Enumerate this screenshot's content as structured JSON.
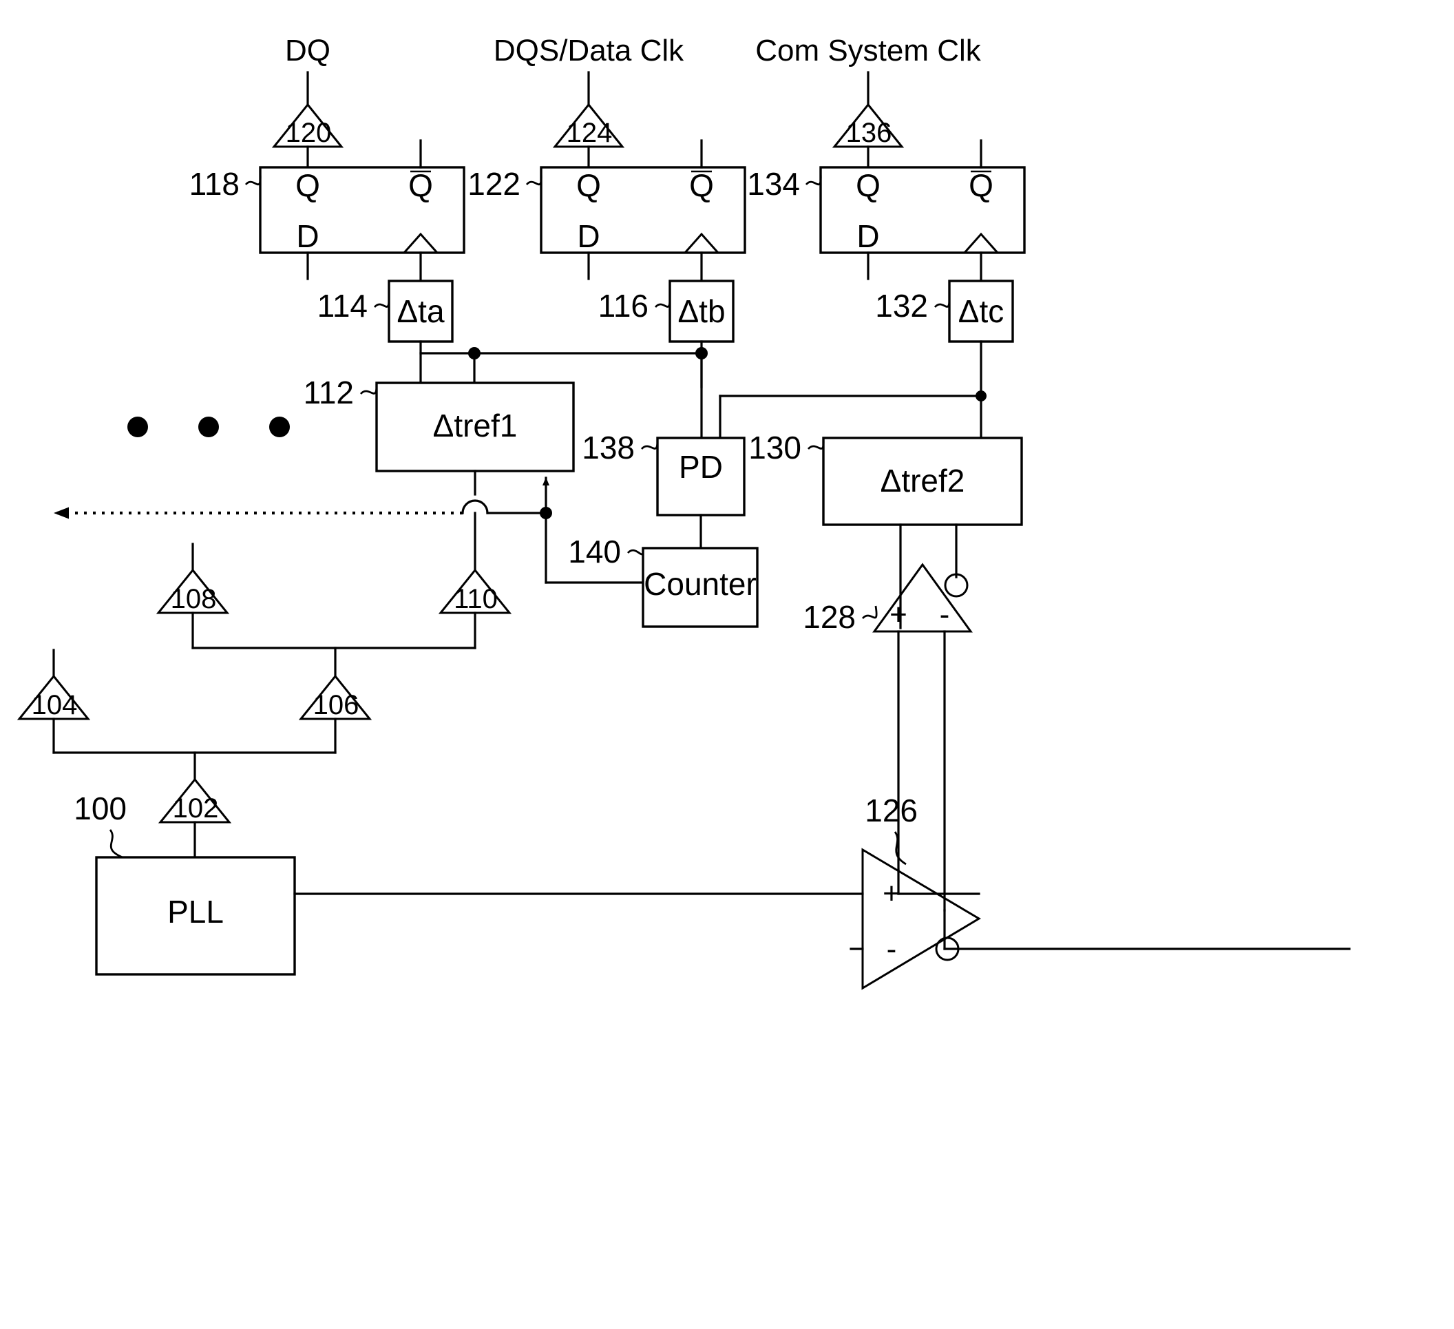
{
  "figure": {
    "type": "patent-circuit-diagram",
    "background": "#ffffff",
    "line_color": "#000000"
  },
  "signal_labels": {
    "dq": "DQ",
    "dqs": "DQS/Data Clk",
    "com_clk": "Com System Clk"
  },
  "flipflops": [
    {
      "ref": "118",
      "q": "Q",
      "qbar": "Q",
      "d": "D"
    },
    {
      "ref": "122",
      "q": "Q",
      "qbar": "Q",
      "d": "D"
    },
    {
      "ref": "134",
      "q": "Q",
      "qbar": "Q",
      "d": "D"
    }
  ],
  "buffers": [
    {
      "ref": "120"
    },
    {
      "ref": "124"
    },
    {
      "ref": "136"
    },
    {
      "ref": "102"
    },
    {
      "ref": "104"
    },
    {
      "ref": "106"
    },
    {
      "ref": "108"
    },
    {
      "ref": "110"
    }
  ],
  "delay_blocks": [
    {
      "ref": "114",
      "label": "Δta"
    },
    {
      "ref": "116",
      "label": "Δtb"
    },
    {
      "ref": "132",
      "label": "Δtc"
    },
    {
      "ref": "112",
      "label": "Δtref1"
    },
    {
      "ref": "130",
      "label": "Δtref2"
    }
  ],
  "logic_blocks": [
    {
      "ref": "100",
      "label": "PLL"
    },
    {
      "ref": "138",
      "label": "PD"
    },
    {
      "ref": "140",
      "label": "Counter"
    }
  ],
  "comparators": [
    {
      "ref": "126",
      "plus": "+",
      "minus": "-",
      "orientation": "right",
      "inverted_output": true
    },
    {
      "ref": "128",
      "plus": "+",
      "minus": "-",
      "orientation": "up",
      "inverted_output": true
    }
  ],
  "ellipsis": {
    "count": 3,
    "meaning": "repeated-channels"
  },
  "reference_numerals": [
    "100",
    "102",
    "104",
    "106",
    "108",
    "110",
    "112",
    "114",
    "116",
    "118",
    "120",
    "122",
    "124",
    "126",
    "128",
    "130",
    "132",
    "134",
    "136",
    "138",
    "140"
  ]
}
